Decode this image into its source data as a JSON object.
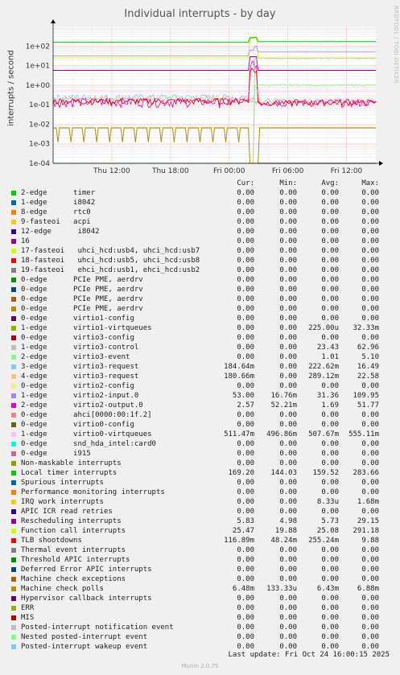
{
  "chart_data": {
    "type": "line",
    "title": "Individual interrupts - by day",
    "ylabel": "interrupts / second",
    "yscale": "log",
    "ylim": [
      0.0001,
      1000
    ],
    "y_ticks": [
      "1e+02",
      "1e+01",
      "1e+00",
      "1e-01",
      "1e-02",
      "1e-03",
      "1e-04"
    ],
    "x_ticks": [
      "Thu 12:00",
      "Thu 18:00",
      "Fri 00:00",
      "Fri 06:00",
      "Fri 12:00"
    ],
    "grid": true,
    "legend_placement": "bottom"
  },
  "vendor_text": "RRDTOOL / TOBI OETIKER",
  "legend": {
    "headers": {
      "cur": "Cur:",
      "min": "Min:",
      "avg": "Avg:",
      "max": "Max:"
    },
    "rows": [
      {
        "name": "2-edge      timer",
        "color": "#00cc00",
        "cur": "0.00",
        "min": "0.00",
        "avg": "0.00",
        "max": "0.00"
      },
      {
        "name": "1-edge      i8042",
        "color": "#0066b3",
        "cur": "0.00",
        "min": "0.00",
        "avg": "0.00",
        "max": "0.00"
      },
      {
        "name": "8-edge      rtc0",
        "color": "#ff8000",
        "cur": "0.00",
        "min": "0.00",
        "avg": "0.00",
        "max": "0.00"
      },
      {
        "name": "9-fasteoi   acpi",
        "color": "#ffcc00",
        "cur": "0.00",
        "min": "0.00",
        "avg": "0.00",
        "max": "0.00"
      },
      {
        "name": "12-edge      i8042",
        "color": "#330099",
        "cur": "0.00",
        "min": "0.00",
        "avg": "0.00",
        "max": "0.00"
      },
      {
        "name": "16",
        "color": "#990099",
        "cur": "0.00",
        "min": "0.00",
        "avg": "0.00",
        "max": "0.00"
      },
      {
        "name": "17-fasteoi   uhci_hcd:usb4, uhci_hcd:usb7",
        "color": "#ccff00",
        "cur": "0.00",
        "min": "0.00",
        "avg": "0.00",
        "max": "0.00"
      },
      {
        "name": "18-fasteoi   uhci_hcd:usb5, uhci_hcd:usb8",
        "color": "#ff0000",
        "cur": "0.00",
        "min": "0.00",
        "avg": "0.00",
        "max": "0.00"
      },
      {
        "name": "19-fasteoi   ehci_hcd:usb1, ehci_hcd:usb2",
        "color": "#808080",
        "cur": "0.00",
        "min": "0.00",
        "avg": "0.00",
        "max": "0.00"
      },
      {
        "name": "0-edge      PCIe PME, aerdrv",
        "color": "#008f00",
        "cur": "0.00",
        "min": "0.00",
        "avg": "0.00",
        "max": "0.00"
      },
      {
        "name": "0-edge      PCIe PME, aerdrv",
        "color": "#00487d",
        "cur": "0.00",
        "min": "0.00",
        "avg": "0.00",
        "max": "0.00"
      },
      {
        "name": "0-edge      PCIe PME, aerdrv",
        "color": "#b35a00",
        "cur": "0.00",
        "min": "0.00",
        "avg": "0.00",
        "max": "0.00"
      },
      {
        "name": "0-edge      PCIe PME, aerdrv",
        "color": "#b38f00",
        "cur": "0.00",
        "min": "0.00",
        "avg": "0.00",
        "max": "0.00"
      },
      {
        "name": "0-edge      virtio1-config",
        "color": "#6b006b",
        "cur": "0.00",
        "min": "0.00",
        "avg": "0.00",
        "max": "0.00"
      },
      {
        "name": "1-edge      virtio1-virtqueues",
        "color": "#8fb300",
        "cur": "0.00",
        "min": "0.00",
        "avg": "225.00u",
        "max": "32.33m"
      },
      {
        "name": "0-edge      virtio3-config",
        "color": "#b30000",
        "cur": "0.00",
        "min": "0.00",
        "avg": "0.00",
        "max": "0.00"
      },
      {
        "name": "1-edge      virtio3-control",
        "color": "#bebebe",
        "cur": "0.00",
        "min": "0.00",
        "avg": "23.43",
        "max": "62.96"
      },
      {
        "name": "2-edge      virtio3-event",
        "color": "#80ff80",
        "cur": "0.00",
        "min": "0.00",
        "avg": "1.01",
        "max": "5.10"
      },
      {
        "name": "3-edge      virtio3-request",
        "color": "#80c9ff",
        "cur": "184.64m",
        "min": "0.00",
        "avg": "222.62m",
        "max": "16.49"
      },
      {
        "name": "4-edge      virtio3-request",
        "color": "#ffc080",
        "cur": "180.66m",
        "min": "0.00",
        "avg": "289.12m",
        "max": "22.58"
      },
      {
        "name": "0-edge      virtio2-config",
        "color": "#ffe680",
        "cur": "0.00",
        "min": "0.00",
        "avg": "0.00",
        "max": "0.00"
      },
      {
        "name": "1-edge      virtio2-input.0",
        "color": "#aa80ff",
        "cur": "53.00",
        "min": "16.76m",
        "avg": "31.36",
        "max": "109.95"
      },
      {
        "name": "2-edge      virtio2-output.0",
        "color": "#ee00cc",
        "cur": "2.57",
        "min": "52.21m",
        "avg": "1.69",
        "max": "51.77"
      },
      {
        "name": "0-edge      ahci[0000:00:1f.2]",
        "color": "#ff8080",
        "cur": "0.00",
        "min": "0.00",
        "avg": "0.00",
        "max": "0.00"
      },
      {
        "name": "0-edge      virtio0-config",
        "color": "#666600",
        "cur": "0.00",
        "min": "0.00",
        "avg": "0.00",
        "max": "0.00"
      },
      {
        "name": "1-edge      virtio0-virtqueues",
        "color": "#ffbfff",
        "cur": "511.47m",
        "min": "496.86m",
        "avg": "507.67m",
        "max": "555.11m"
      },
      {
        "name": "0-edge      snd_hda_intel:card0",
        "color": "#00ffcc",
        "cur": "0.00",
        "min": "0.00",
        "avg": "0.00",
        "max": "0.00"
      },
      {
        "name": "0-edge      i915",
        "color": "#cc6699",
        "cur": "0.00",
        "min": "0.00",
        "avg": "0.00",
        "max": "0.00"
      },
      {
        "name": "Non-maskable interrupts",
        "color": "#999900",
        "cur": "0.00",
        "min": "0.00",
        "avg": "0.00",
        "max": "0.00"
      },
      {
        "name": "Local timer interrupts",
        "color": "#00cc00",
        "cur": "169.20",
        "min": "144.03",
        "avg": "159.52",
        "max": "283.66"
      },
      {
        "name": "Spurious interrupts",
        "color": "#0066b3",
        "cur": "0.00",
        "min": "0.00",
        "avg": "0.00",
        "max": "0.00"
      },
      {
        "name": "Performance monitoring interrupts",
        "color": "#ff8000",
        "cur": "0.00",
        "min": "0.00",
        "avg": "0.00",
        "max": "0.00"
      },
      {
        "name": "IRQ work interrupts",
        "color": "#ffcc00",
        "cur": "0.00",
        "min": "0.00",
        "avg": "8.33u",
        "max": "1.68m"
      },
      {
        "name": "APIC ICR read retries",
        "color": "#330099",
        "cur": "0.00",
        "min": "0.00",
        "avg": "0.00",
        "max": "0.00"
      },
      {
        "name": "Rescheduling interrupts",
        "color": "#990099",
        "cur": "5.83",
        "min": "4.98",
        "avg": "5.73",
        "max": "29.15"
      },
      {
        "name": "Function call interrupts",
        "color": "#ccff00",
        "cur": "25.47",
        "min": "19.88",
        "avg": "25.08",
        "max": "291.18"
      },
      {
        "name": "TLB shootdowns",
        "color": "#ff0000",
        "cur": "116.89m",
        "min": "48.24m",
        "avg": "255.24m",
        "max": "9.88"
      },
      {
        "name": "Thermal event interrupts",
        "color": "#808080",
        "cur": "0.00",
        "min": "0.00",
        "avg": "0.00",
        "max": "0.00"
      },
      {
        "name": "Threshold APIC interrupts",
        "color": "#008f00",
        "cur": "0.00",
        "min": "0.00",
        "avg": "0.00",
        "max": "0.00"
      },
      {
        "name": "Deferred Error APIC interrupts",
        "color": "#00487d",
        "cur": "0.00",
        "min": "0.00",
        "avg": "0.00",
        "max": "0.00"
      },
      {
        "name": "Machine check exceptions",
        "color": "#b35a00",
        "cur": "0.00",
        "min": "0.00",
        "avg": "0.00",
        "max": "0.00"
      },
      {
        "name": "Machine check polls",
        "color": "#b38f00",
        "cur": "6.48m",
        "min": "133.33u",
        "avg": "6.43m",
        "max": "6.88m"
      },
      {
        "name": "Hypervisor callback interrupts",
        "color": "#6b006b",
        "cur": "0.00",
        "min": "0.00",
        "avg": "0.00",
        "max": "0.00"
      },
      {
        "name": "ERR",
        "color": "#8fb300",
        "cur": "0.00",
        "min": "0.00",
        "avg": "0.00",
        "max": "0.00"
      },
      {
        "name": "MIS",
        "color": "#b30000",
        "cur": "0.00",
        "min": "0.00",
        "avg": "0.00",
        "max": "0.00"
      },
      {
        "name": "Posted-interrupt notification event",
        "color": "#bebebe",
        "cur": "0.00",
        "min": "0.00",
        "avg": "0.00",
        "max": "0.00"
      },
      {
        "name": "Nested posted-interrupt event",
        "color": "#80ff80",
        "cur": "0.00",
        "min": "0.00",
        "avg": "0.00",
        "max": "0.00"
      },
      {
        "name": "Posted-interrupt wakeup event",
        "color": "#80c9ff",
        "cur": "0.00",
        "min": "0.00",
        "avg": "0.00",
        "max": "0.00"
      }
    ]
  },
  "last_update": "Last update: Fri Oct 24 16:00:15 2025",
  "footer": "Munin 2.0.75"
}
